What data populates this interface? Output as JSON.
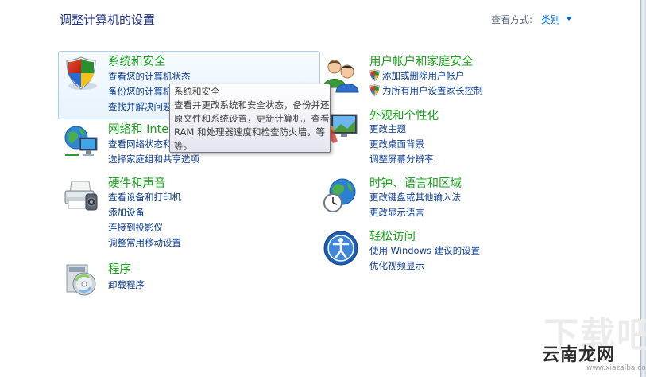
{
  "header": {
    "title": "调整计算机的设置",
    "view_by_label": "查看方式:",
    "view_by_value": "类别"
  },
  "categories": [
    {
      "title": "系统和安全",
      "icon": "system-security-icon",
      "links": [
        "查看您的计算机状态",
        "备份您的计算机",
        "查找并解决问题"
      ]
    },
    {
      "title": "网络和 Internet",
      "icon": "network-globe-icon",
      "links": [
        "查看网络状态和任务",
        "选择家庭组和共享选项"
      ]
    },
    {
      "title": "硬件和声音",
      "icon": "printer-icon",
      "links": [
        "查看设备和打印机",
        "添加设备",
        "连接到投影仪",
        "调整常用移动设置"
      ]
    },
    {
      "title": "程序",
      "icon": "programs-disc-icon",
      "links": [
        "卸载程序"
      ]
    },
    {
      "title": "用户帐户和家庭安全",
      "icon": "users-icon",
      "links": [
        "添加或删除用户帐户",
        "为所有用户设置家长控制"
      ]
    },
    {
      "title": "外观和个性化",
      "icon": "appearance-monitor-icon",
      "links": [
        "更改主题",
        "更改桌面背景",
        "调整屏幕分辨率"
      ]
    },
    {
      "title": "时钟、语言和区域",
      "icon": "clock-globe-icon",
      "links": [
        "更改键盘或其他输入法",
        "更改显示语言"
      ]
    },
    {
      "title": "轻松访问",
      "icon": "ease-of-access-icon",
      "links": [
        "使用 Windows 建议的设置",
        "优化视频显示"
      ]
    }
  ],
  "tooltip": {
    "title": "系统和安全",
    "body": "查看并更改系统和安全状态，备份并还原文件和系统设置，更新计算机，查看 RAM 和处理器速度和检查防火墙，等等。"
  },
  "watermark": {
    "brand": "云南龙网",
    "url": "www.xiazaiba.com",
    "ghost": "下载吧"
  },
  "colors": {
    "title_blue": "#1e3287",
    "category_green": "#18a11b",
    "link_blue": "#0b3d91",
    "hover_border": "#a8d0f0"
  }
}
